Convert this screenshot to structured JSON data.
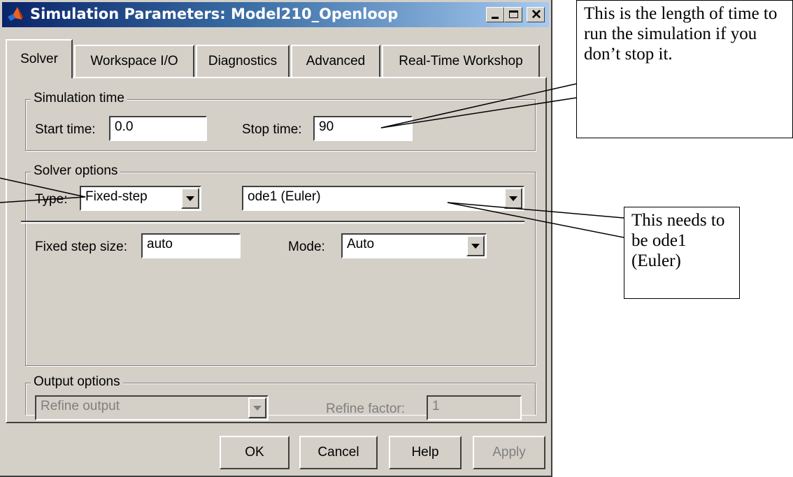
{
  "window": {
    "title": "Simulation Parameters: Model210_Openloop"
  },
  "tabs": [
    {
      "label": "Solver",
      "active": true
    },
    {
      "label": "Workspace I/O",
      "active": false
    },
    {
      "label": "Diagnostics",
      "active": false
    },
    {
      "label": "Advanced",
      "active": false
    },
    {
      "label": "Real-Time Workshop",
      "active": false
    }
  ],
  "simulation_time": {
    "legend": "Simulation time",
    "start_label": "Start time:",
    "start_value": "0.0",
    "stop_label": "Stop time:",
    "stop_value": "90"
  },
  "solver_options": {
    "legend": "Solver options",
    "type_label": "Type:",
    "type_value": "Fixed-step",
    "solver_value": "ode1 (Euler)",
    "step_label": "Fixed step size:",
    "step_value": "auto",
    "mode_label": "Mode:",
    "mode_value": "Auto"
  },
  "output_options": {
    "legend": "Output options",
    "refine_value": "Refine output",
    "refine_factor_label": "Refine factor:",
    "refine_factor_value": "1"
  },
  "buttons": {
    "ok": "OK",
    "cancel": "Cancel",
    "help": "Help",
    "apply": "Apply"
  },
  "callouts": {
    "stop_time_note": "This is the length of time to run the simulation if you don’t stop it.",
    "solver_note": "This needs to be ode1 (Euler)"
  },
  "colors": {
    "dialog_bg": "#d4d0c8",
    "titlebar_start": "#0a246a",
    "titlebar_end": "#a6caf0"
  }
}
